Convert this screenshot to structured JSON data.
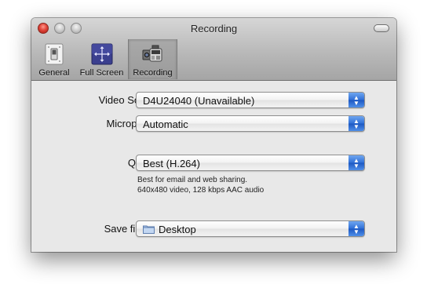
{
  "window": {
    "title": "Recording"
  },
  "toolbar": {
    "items": [
      {
        "label": "General",
        "icon": "switch-icon",
        "selected": false
      },
      {
        "label": "Full Screen",
        "icon": "fullscreen-arrows-icon",
        "selected": false
      },
      {
        "label": "Recording",
        "icon": "camcorder-icon",
        "selected": true
      }
    ]
  },
  "form": {
    "video_source": {
      "label": "Video Source:",
      "value": "D4U24040 (Unavailable)"
    },
    "microphone": {
      "label": "Microphone:",
      "value": "Automatic"
    },
    "quality": {
      "label": "Quality:",
      "value": "Best (H.264)",
      "hint_line1": "Best for email and web sharing.",
      "hint_line2": "640x480 video, 128 kbps AAC audio"
    },
    "save_files": {
      "label": "Save files to:",
      "value": "Desktop",
      "icon": "folder-icon"
    }
  },
  "colors": {
    "accent_blue": "#2f6fd6",
    "close_red": "#e0443a",
    "selected_tab": "#9b9b9b"
  }
}
